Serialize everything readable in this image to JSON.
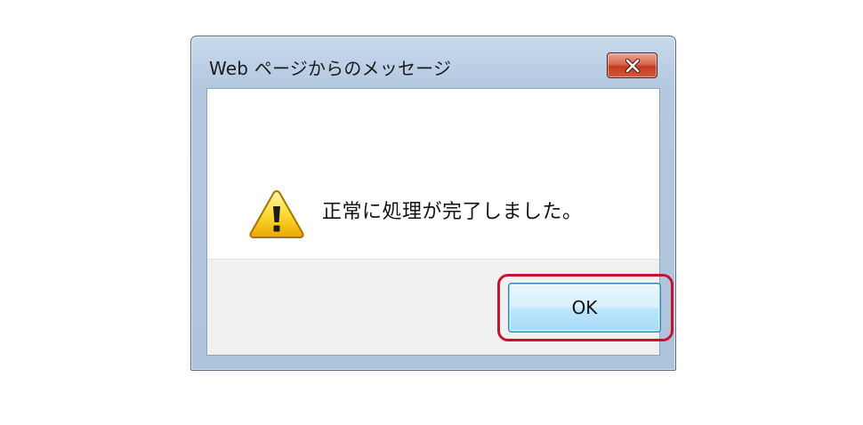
{
  "dialog": {
    "title": "Web ページからのメッセージ",
    "message": "正常に処理が完了しました。",
    "ok_label": "OK",
    "close_icon": "close-icon",
    "message_icon": "warning-icon"
  },
  "colors": {
    "highlight_ring": "#c8142b",
    "close_button": "#c23b22",
    "ok_button": "#bee6fd",
    "frame": "#b4c8df"
  }
}
